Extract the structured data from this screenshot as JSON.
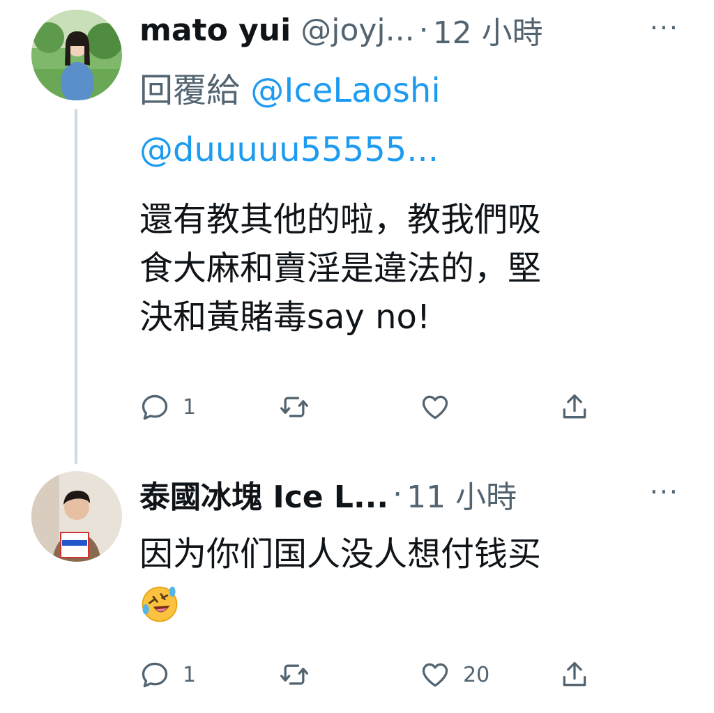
{
  "tweets": [
    {
      "name": "mato yui",
      "handle": "@joyj...",
      "separator": "·",
      "time": "12 小時",
      "more": "···",
      "reply_prefix": "回覆給",
      "reply_mention_1": "@IceLaoshi",
      "reply_mention_2": "@duuuuu55555...",
      "text_line_1": "還有教其他的啦，教我們吸",
      "text_line_2": "食大麻和賣淫是違法的，堅",
      "text_line_3": "決和黃賭毒say no!",
      "reply_count": "1",
      "retweet_count": "",
      "like_count": ""
    },
    {
      "name": "泰國冰塊 Ice L...",
      "separator": "·",
      "time": "11 小時",
      "more": "···",
      "text_line_1": "因为你们国人没人想付钱买",
      "emoji": "rolling-on-floor-laughing",
      "reply_count": "1",
      "retweet_count": "",
      "like_count": "20"
    }
  ],
  "icons": {
    "reply": "reply-icon",
    "retweet": "retweet-icon",
    "like": "like-icon",
    "share": "share-icon"
  },
  "colors": {
    "link": "#1d9bf0",
    "secondary": "#536471",
    "thread_line": "#cfd9de"
  }
}
